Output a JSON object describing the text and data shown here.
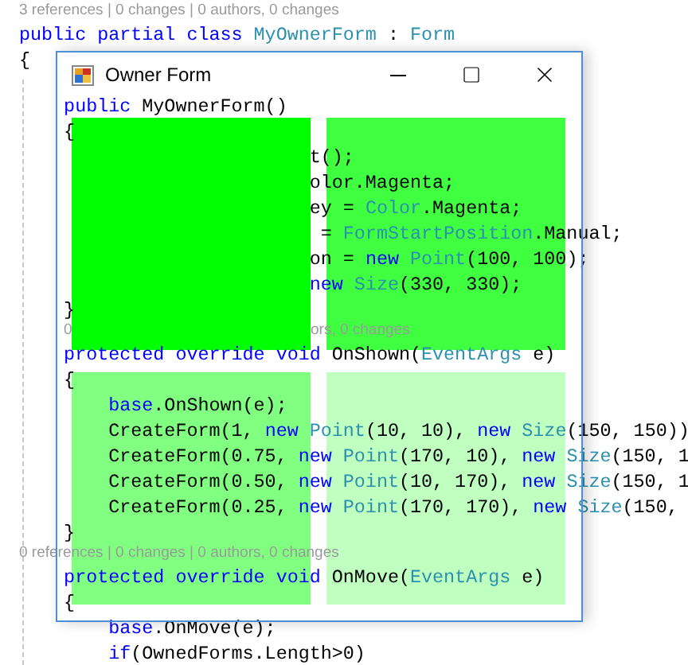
{
  "editor": {
    "lines_above": [
      {
        "kind": "codelens",
        "segments": [
          "3 references | 0 changes | 0 authors, 0 changes"
        ]
      },
      {
        "kind": "code",
        "tokens": [
          {
            "text": "public partial class ",
            "kind": "keyword"
          },
          {
            "text": "MyOwnerForm",
            "kind": "type"
          },
          {
            "text": " : ",
            "kind": "plain"
          },
          {
            "text": "Form",
            "kind": "type"
          }
        ]
      },
      {
        "kind": "code",
        "tokens": [
          {
            "text": "{",
            "kind": "plain"
          }
        ]
      }
    ],
    "lines_below": [
      {
        "kind": "code",
        "tokens": [
          {
            "text": "    public ",
            "kind": "keyword"
          },
          {
            "text": "MyOwnerForm()",
            "kind": "plain"
          }
        ]
      },
      {
        "kind": "code",
        "tokens": [
          {
            "text": "    {",
            "kind": "plain"
          }
        ]
      },
      {
        "kind": "code",
        "tokens": [
          {
            "text": "                          t();",
            "kind": "plain"
          }
        ]
      },
      {
        "kind": "code",
        "tokens": [
          {
            "text": "                          olor.Magenta;",
            "kind": "plain"
          }
        ]
      },
      {
        "kind": "code",
        "tokens": [
          {
            "text": "                          ey = ",
            "kind": "plain"
          },
          {
            "text": "Color",
            "kind": "type"
          },
          {
            "text": ".Magenta;",
            "kind": "plain"
          }
        ]
      },
      {
        "kind": "code",
        "tokens": [
          {
            "text": "                           = ",
            "kind": "plain"
          },
          {
            "text": "FormStartPosition",
            "kind": "type"
          },
          {
            "text": ".Manual;",
            "kind": "plain"
          }
        ]
      },
      {
        "kind": "code",
        "tokens": [
          {
            "text": "                          on = ",
            "kind": "plain"
          },
          {
            "text": "new ",
            "kind": "keyword"
          },
          {
            "text": "Point",
            "kind": "type"
          },
          {
            "text": "(100, 100);",
            "kind": "plain"
          }
        ]
      },
      {
        "kind": "code",
        "tokens": [
          {
            "text": "                          new ",
            "kind": "keyword"
          },
          {
            "text": "Size",
            "kind": "type"
          },
          {
            "text": "(330, 330);",
            "kind": "plain"
          }
        ]
      },
      {
        "kind": "code",
        "tokens": [
          {
            "text": "    }",
            "kind": "plain"
          }
        ]
      },
      {
        "kind": "codelens",
        "segments": [
          "0",
          "ors, 0 changes"
        ]
      },
      {
        "kind": "code",
        "tokens": [
          {
            "text": "    protected override void ",
            "kind": "keyword"
          },
          {
            "text": "OnShown(",
            "kind": "plain"
          },
          {
            "text": "EventArgs",
            "kind": "type"
          },
          {
            "text": " e)",
            "kind": "plain"
          }
        ]
      },
      {
        "kind": "code",
        "tokens": [
          {
            "text": "    {",
            "kind": "plain"
          }
        ]
      },
      {
        "kind": "code",
        "tokens": [
          {
            "text": "        base",
            "kind": "keyword"
          },
          {
            "text": ".OnShown(e);",
            "kind": "plain"
          }
        ]
      },
      {
        "kind": "code",
        "tokens": [
          {
            "text": "        CreateForm(1, ",
            "kind": "plain"
          },
          {
            "text": "new ",
            "kind": "keyword"
          },
          {
            "text": "Point",
            "kind": "type"
          },
          {
            "text": "(10, 10), ",
            "kind": "plain"
          },
          {
            "text": "new ",
            "kind": "keyword"
          },
          {
            "text": "Size",
            "kind": "type"
          },
          {
            "text": "(150, 150))",
            "kind": "plain"
          }
        ]
      },
      {
        "kind": "code",
        "tokens": [
          {
            "text": "        CreateForm(0.75, ",
            "kind": "plain"
          },
          {
            "text": "new ",
            "kind": "keyword"
          },
          {
            "text": "Point",
            "kind": "type"
          },
          {
            "text": "(170, 10), ",
            "kind": "plain"
          },
          {
            "text": "new ",
            "kind": "keyword"
          },
          {
            "text": "Size",
            "kind": "type"
          },
          {
            "text": "(150, 1",
            "kind": "plain"
          }
        ]
      },
      {
        "kind": "code",
        "tokens": [
          {
            "text": "        CreateForm(0.50, ",
            "kind": "plain"
          },
          {
            "text": "new ",
            "kind": "keyword"
          },
          {
            "text": "Point",
            "kind": "type"
          },
          {
            "text": "(10, 170), ",
            "kind": "plain"
          },
          {
            "text": "new ",
            "kind": "keyword"
          },
          {
            "text": "Size",
            "kind": "type"
          },
          {
            "text": "(150, 1",
            "kind": "plain"
          }
        ]
      },
      {
        "kind": "code",
        "tokens": [
          {
            "text": "        CreateForm(0.25, ",
            "kind": "plain"
          },
          {
            "text": "new ",
            "kind": "keyword"
          },
          {
            "text": "Point",
            "kind": "type"
          },
          {
            "text": "(170, 170), ",
            "kind": "plain"
          },
          {
            "text": "new ",
            "kind": "keyword"
          },
          {
            "text": "Size",
            "kind": "type"
          },
          {
            "text": "(150,",
            "kind": "plain"
          }
        ]
      },
      {
        "kind": "code",
        "tokens": [
          {
            "text": "    }",
            "kind": "plain"
          }
        ]
      },
      {
        "kind": "codelens",
        "segments": [
          "0 references | 0 changes | 0 authors, 0 changes"
        ]
      },
      {
        "kind": "code",
        "tokens": [
          {
            "text": "    protected override void ",
            "kind": "keyword"
          },
          {
            "text": "OnMove(",
            "kind": "plain"
          },
          {
            "text": "EventArgs",
            "kind": "type"
          },
          {
            "text": " e)",
            "kind": "plain"
          }
        ]
      },
      {
        "kind": "code",
        "tokens": [
          {
            "text": "    {",
            "kind": "plain"
          }
        ]
      },
      {
        "kind": "code",
        "tokens": [
          {
            "text": "        base",
            "kind": "keyword"
          },
          {
            "text": ".OnMove(e);",
            "kind": "plain"
          }
        ]
      },
      {
        "kind": "code",
        "tokens": [
          {
            "text": "        if",
            "kind": "keyword"
          },
          {
            "text": "(OwnedForms.Length>0)",
            "kind": "plain"
          }
        ]
      }
    ]
  },
  "window": {
    "title": "Owner Form"
  },
  "owned_forms": [
    {
      "color": "#00ff00"
    },
    {
      "color": "#40ff40"
    },
    {
      "color": "#80ff80"
    },
    {
      "color": "#bfffbf"
    }
  ]
}
